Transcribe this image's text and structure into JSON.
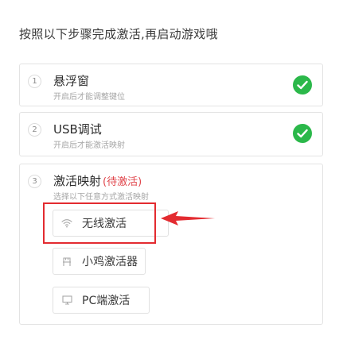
{
  "header": {
    "title": "按照以下步骤完成激活,再启动游戏哦"
  },
  "steps": [
    {
      "number": "1",
      "title": "悬浮窗",
      "subtitle": "开启后才能调整键位",
      "status": "done"
    },
    {
      "number": "2",
      "title": "USB调试",
      "subtitle": "开启后才能激活映射",
      "status": "done"
    },
    {
      "number": "3",
      "title": "激活映射",
      "status_label": "(待激活)",
      "subtitle": "选择以下任意方式激活映射",
      "status": "pending"
    }
  ],
  "options": [
    {
      "label": "无线激活",
      "icon": "wifi-icon"
    },
    {
      "label": "小鸡激活器",
      "icon": "gamepad-adapter-icon"
    },
    {
      "label": "PC端激活",
      "icon": "monitor-icon"
    }
  ],
  "colors": {
    "success": "#2bb84a",
    "pending": "#e0454b",
    "annotation": "#e32b30"
  }
}
